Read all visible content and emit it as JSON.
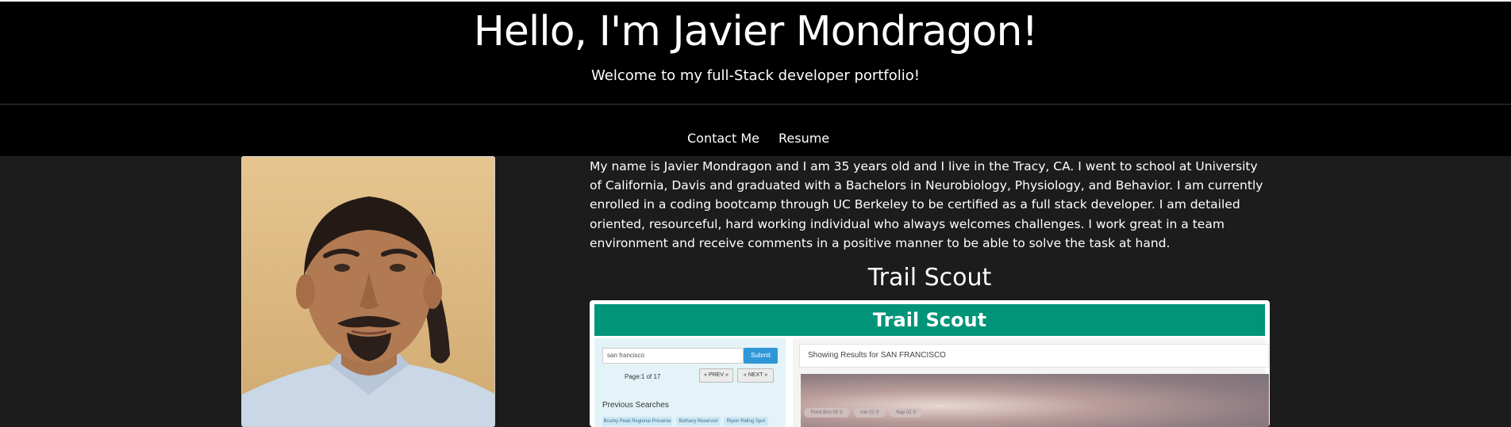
{
  "header": {
    "title": "Hello, I'm Javier Mondragon!",
    "subtitle": "Welcome to my full-Stack developer portfolio!"
  },
  "nav": {
    "items": [
      {
        "label": "Contact Me"
      },
      {
        "label": "Resume"
      }
    ]
  },
  "profile": {
    "photo_alt": "Photo of Javier Mondragon"
  },
  "bio": {
    "text": "My name is Javier Mondragon and I am 35 years old and I live in the Tracy, CA. I went to school at University of California, Davis and graduated with a Bachelors in Neurobiology, Physiology, and Behavior. I am currently enrolled in a coding bootcamp through UC Berkeley to be certified as a full stack developer. I am detailed oriented, resourceful, hard working individual who always welcomes challenges. I work great in a team environment and receive comments in a positive manner to be able to solve the task at hand."
  },
  "project": {
    "title": "Trail Scout",
    "screenshot": {
      "app_title": "Trail Scout",
      "search_value": "san francisco",
      "submit_label": "Submit",
      "page_text": "Page:1 of 17",
      "prev_label": "« PREV »",
      "next_label": "« NEXT »",
      "previous_searches_label": "Previous Searches",
      "previous_searches": [
        "Brushy Peak Regional Preserve",
        "Bethany Reservoir",
        "Ripon Riding Spot"
      ],
      "results_text": "Showing Results for SAN FRANCISCO",
      "tags": [
        "Point Bon 02 ⚲",
        "Isle 02 ⚲",
        "Nap 02 ⚲"
      ]
    }
  },
  "colors": {
    "header_bg": "#000000",
    "page_bg": "#1c1c1c",
    "app_bar": "#009479",
    "submit": "#2f96d8"
  }
}
